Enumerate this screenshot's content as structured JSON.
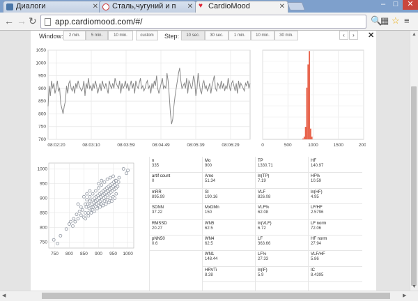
{
  "browser": {
    "tabs": [
      {
        "title": "Диалоги",
        "icon_color": "#4a76a8"
      },
      {
        "title": "Сталь,чугуний и п",
        "icon_color": "#c33"
      },
      {
        "title": "CardioMood",
        "icon_color": "#d23"
      }
    ],
    "url": "app.cardiomood.com/#/",
    "controls": {
      "minimize": "–",
      "maximize": "□",
      "close": "✕"
    }
  },
  "toolbar": {
    "window_label": "Window:",
    "window_options": [
      "2 min.",
      "5 min.",
      "10 min.",
      "custom"
    ],
    "window_selected": 1,
    "step_label": "Step:",
    "step_options": [
      "10 sec.",
      "30 sec.",
      "1 min.",
      "10 min.",
      "30 min."
    ],
    "step_selected": 0,
    "prev": "‹",
    "next": "›",
    "close": "✕"
  },
  "chart_data": [
    {
      "type": "line",
      "ylim": [
        700,
        1050
      ],
      "yticks": [
        "700",
        "750",
        "800",
        "850",
        "900",
        "950",
        "1000",
        "1050"
      ],
      "xticks": [
        "08:02:20",
        "08:03:10",
        "08:03:59",
        "08:04:49",
        "08:05:39",
        "08:06:29"
      ],
      "color": "#888888",
      "values": [
        830,
        910,
        870,
        930,
        900,
        920,
        880,
        900,
        930,
        890,
        900,
        840,
        820,
        800,
        830,
        850,
        910,
        880,
        920,
        930,
        900,
        890,
        910,
        880,
        920,
        900,
        930,
        910,
        900,
        890,
        900,
        930,
        870,
        920,
        900,
        940,
        900,
        910,
        890,
        920,
        900,
        930,
        910,
        880,
        900,
        920,
        890,
        930,
        910,
        900,
        920,
        900,
        880,
        930,
        910,
        900,
        920,
        900,
        940,
        920,
        910,
        900,
        930,
        880,
        920,
        900,
        910,
        930,
        900,
        920,
        890,
        910,
        930,
        900,
        920,
        880,
        930,
        910,
        900,
        920,
        940,
        900,
        910,
        890,
        900,
        920,
        930,
        900,
        910,
        880,
        920,
        900,
        930,
        910,
        950,
        900,
        880,
        900,
        920,
        940,
        900,
        910,
        900,
        960,
        930,
        870,
        800,
        760,
        780,
        830,
        870,
        900,
        930,
        960,
        980,
        930,
        900,
        910,
        920,
        900,
        940,
        880,
        930,
        920,
        900,
        910,
        950,
        930,
        870,
        900,
        960,
        920,
        890,
        880,
        920,
        930,
        900,
        910,
        890,
        900,
        920,
        880,
        910,
        930,
        950,
        900,
        890,
        920,
        910,
        900,
        930,
        900,
        920,
        890,
        910,
        900,
        940,
        910,
        890,
        920,
        930,
        910,
        890,
        920,
        880,
        930,
        900,
        920,
        910,
        900,
        890,
        920,
        910,
        930,
        900,
        920
      ]
    },
    {
      "type": "bar",
      "ylim": [
        0,
        1
      ],
      "xlim": [
        0,
        2000
      ],
      "xticks": [
        "0",
        "500",
        "1000",
        "1500",
        "2000"
      ],
      "color": "#e8624a",
      "bins": [
        {
          "x": 800,
          "value": 0.01
        },
        {
          "x": 825,
          "value": 0.03
        },
        {
          "x": 850,
          "value": 0.14
        },
        {
          "x": 875,
          "value": 0.58
        },
        {
          "x": 900,
          "value": 0.84
        },
        {
          "x": 925,
          "value": 0.99
        },
        {
          "x": 950,
          "value": 0.12
        },
        {
          "x": 975,
          "value": 0.03
        }
      ]
    },
    {
      "type": "scatter",
      "xlim": [
        730,
        1020
      ],
      "ylim": [
        730,
        1020
      ],
      "xticks": [
        "750",
        "800",
        "850",
        "900",
        "950",
        "1000"
      ],
      "yticks": [
        "750",
        "800",
        "850",
        "900",
        "950",
        "1000"
      ],
      "color": "#9aa0aa",
      "points": [
        [
          747,
          758
        ],
        [
          760,
          745
        ],
        [
          770,
          772
        ],
        [
          790,
          795
        ],
        [
          800,
          812
        ],
        [
          812,
          805
        ],
        [
          820,
          820
        ],
        [
          830,
          830
        ],
        [
          840,
          842
        ],
        [
          845,
          860
        ],
        [
          850,
          835
        ],
        [
          855,
          850
        ],
        [
          858,
          870
        ],
        [
          862,
          880
        ],
        [
          865,
          850
        ],
        [
          868,
          865
        ],
        [
          870,
          890
        ],
        [
          872,
          876
        ],
        [
          875,
          860
        ],
        [
          877,
          880
        ],
        [
          880,
          895
        ],
        [
          882,
          870
        ],
        [
          884,
          885
        ],
        [
          886,
          900
        ],
        [
          888,
          875
        ],
        [
          890,
          890
        ],
        [
          892,
          905
        ],
        [
          894,
          880
        ],
        [
          896,
          895
        ],
        [
          898,
          910
        ],
        [
          900,
          885
        ],
        [
          902,
          900
        ],
        [
          904,
          915
        ],
        [
          906,
          890
        ],
        [
          908,
          905
        ],
        [
          910,
          920
        ],
        [
          912,
          895
        ],
        [
          914,
          910
        ],
        [
          916,
          925
        ],
        [
          918,
          900
        ],
        [
          920,
          915
        ],
        [
          922,
          930
        ],
        [
          924,
          905
        ],
        [
          926,
          920
        ],
        [
          928,
          935
        ],
        [
          930,
          910
        ],
        [
          932,
          925
        ],
        [
          934,
          940
        ],
        [
          936,
          915
        ],
        [
          938,
          930
        ],
        [
          940,
          945
        ],
        [
          942,
          920
        ],
        [
          944,
          935
        ],
        [
          946,
          950
        ],
        [
          948,
          925
        ],
        [
          950,
          940
        ],
        [
          952,
          955
        ],
        [
          954,
          930
        ],
        [
          956,
          945
        ],
        [
          958,
          960
        ],
        [
          960,
          935
        ],
        [
          962,
          950
        ],
        [
          965,
          940
        ],
        [
          968,
          955
        ],
        [
          855,
          880
        ],
        [
          860,
          895
        ],
        [
          870,
          905
        ],
        [
          880,
          915
        ],
        [
          890,
          925
        ],
        [
          900,
          935
        ],
        [
          910,
          945
        ],
        [
          920,
          955
        ],
        [
          930,
          965
        ],
        [
          940,
          970
        ],
        [
          950,
          975
        ],
        [
          880,
          860
        ],
        [
          890,
          870
        ],
        [
          900,
          875
        ],
        [
          910,
          880
        ],
        [
          920,
          890
        ],
        [
          930,
          895
        ],
        [
          940,
          900
        ],
        [
          950,
          905
        ],
        [
          960,
          915
        ],
        [
          985,
          1000
        ],
        [
          995,
          985
        ],
        [
          1000,
          995
        ],
        [
          970,
          970
        ],
        [
          960,
          960
        ],
        [
          955,
          900
        ],
        [
          945,
          890
        ],
        [
          935,
          885
        ],
        [
          925,
          880
        ],
        [
          915,
          875
        ],
        [
          905,
          870
        ],
        [
          895,
          865
        ],
        [
          885,
          855
        ],
        [
          875,
          850
        ],
        [
          865,
          840
        ],
        [
          855,
          830
        ],
        [
          835,
          855
        ],
        [
          825,
          845
        ],
        [
          815,
          830
        ],
        [
          805,
          820
        ],
        [
          870,
          925
        ],
        [
          860,
          915
        ],
        [
          850,
          905
        ],
        [
          900,
          950
        ],
        [
          910,
          960
        ],
        [
          840,
          870
        ],
        [
          830,
          880
        ]
      ]
    }
  ],
  "stats": {
    "col1": [
      {
        "label": "n",
        "value": "335"
      },
      {
        "label": "artif count",
        "value": "0"
      },
      {
        "label": "mRR",
        "value": "895.99"
      },
      {
        "label": "SDNN",
        "value": "37.22"
      },
      {
        "label": "RMSSD",
        "value": "20.27"
      },
      {
        "label": "pNN50",
        "value": "0.6"
      }
    ],
    "col2": [
      {
        "label": "Mo",
        "value": "900"
      },
      {
        "label": "Amo",
        "value": "51.34"
      },
      {
        "label": "SI",
        "value": "190.16"
      },
      {
        "label": "MxDMn",
        "value": "150"
      },
      {
        "label": "WN5",
        "value": "62.5"
      },
      {
        "label": "WN4",
        "value": "62.5"
      },
      {
        "label": "WN1",
        "value": "148.44"
      },
      {
        "label": "HRVTi",
        "value": "8.38"
      }
    ],
    "col3": [
      {
        "label": "TP",
        "value": "1330.71"
      },
      {
        "label": "ln(TP)",
        "value": "7.19"
      },
      {
        "label": "VLF",
        "value": "826.08"
      },
      {
        "label": "VLF%",
        "value": "62.08"
      },
      {
        "label": "ln(VLF)",
        "value": "6.72"
      },
      {
        "label": "LF",
        "value": "363.66"
      },
      {
        "label": "LF%",
        "value": "27.33"
      },
      {
        "label": "ln(lF)",
        "value": "5.9"
      }
    ],
    "col4": [
      {
        "label": "HF",
        "value": "140.97"
      },
      {
        "label": "HF%",
        "value": "10.59"
      },
      {
        "label": "ln(HF)",
        "value": "4.95"
      },
      {
        "label": "LF/HF",
        "value": "2.5796"
      },
      {
        "label": "LF norm",
        "value": "72.06"
      },
      {
        "label": "HF norm",
        "value": "27.94"
      },
      {
        "label": "VLF/HF",
        "value": "5.86"
      },
      {
        "label": "IC",
        "value": "8.4395"
      }
    ]
  }
}
